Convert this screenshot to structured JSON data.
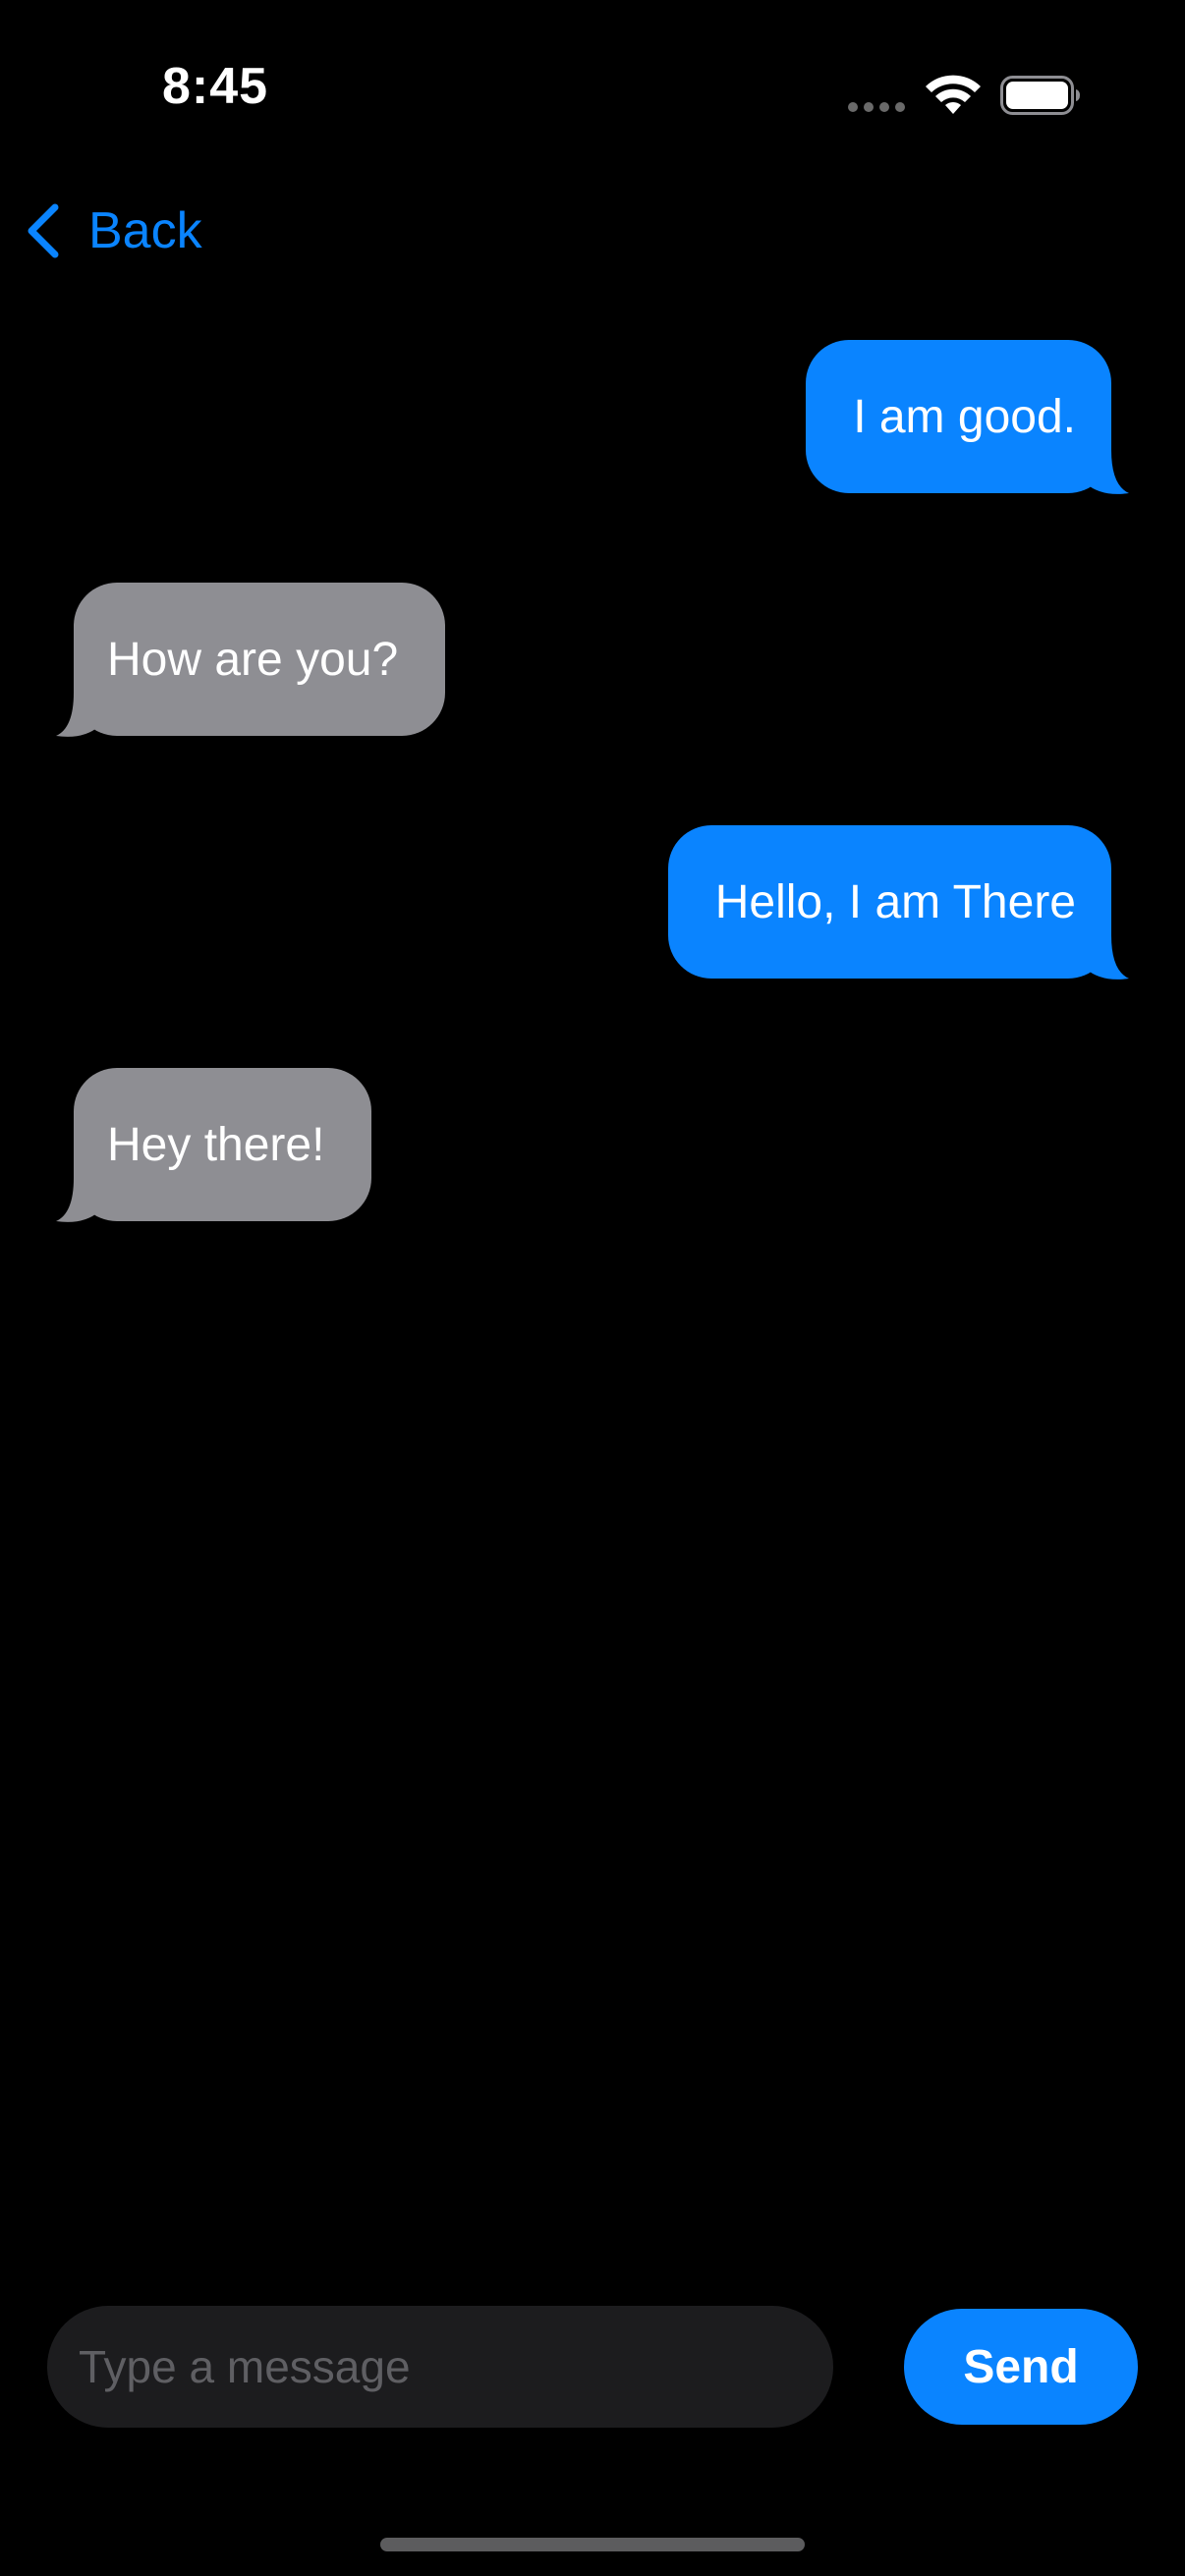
{
  "status_bar": {
    "time": "8:45",
    "icons": [
      "signal-dots-icon",
      "wifi-icon",
      "battery-icon"
    ]
  },
  "navigation": {
    "back_label": "Back",
    "back_icon": "chevron-left-icon"
  },
  "messages": [
    {
      "text": "I am good.",
      "direction": "sent"
    },
    {
      "text": "How are you?",
      "direction": "received"
    },
    {
      "text": "Hello, I am There",
      "direction": "sent"
    },
    {
      "text": "Hey there!",
      "direction": "received"
    }
  ],
  "composer": {
    "placeholder": "Type a message",
    "value": "",
    "send_label": "Send"
  },
  "colors": {
    "background": "#000000",
    "sent_bubble": "#0a84ff",
    "received_bubble": "#8e8e93",
    "accent": "#0a84ff",
    "input_background": "#1c1c1e"
  }
}
